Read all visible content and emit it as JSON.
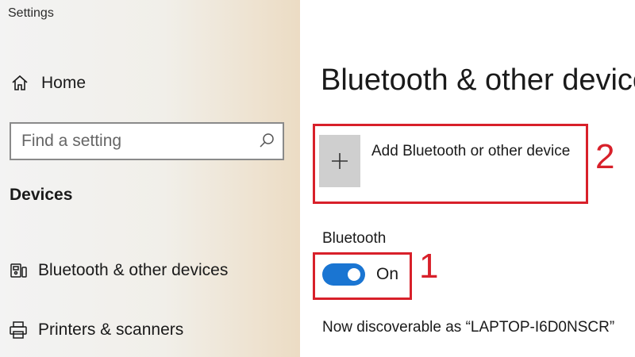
{
  "window": {
    "title": "Settings"
  },
  "sidebar": {
    "home_label": "Home",
    "search": {
      "placeholder": "Find a setting",
      "value": ""
    },
    "section_title": "Devices",
    "items": [
      {
        "label": "Bluetooth & other devices",
        "icon": "bluetooth-devices-icon"
      },
      {
        "label": "Printers & scanners",
        "icon": "printer-icon"
      }
    ]
  },
  "main": {
    "page_title": "Bluetooth & other devices",
    "add_device_label": "Add Bluetooth or other device",
    "bluetooth_section_label": "Bluetooth",
    "bluetooth_toggle": {
      "state": "On",
      "on": true
    },
    "discoverable_text": "Now discoverable as “LAPTOP-I6D0NSCR”"
  },
  "annotations": {
    "callout_1": "1",
    "callout_2": "2",
    "color": "#d8202a"
  },
  "colors": {
    "accent": "#1a75d2",
    "tile": "#cfcfcf"
  }
}
